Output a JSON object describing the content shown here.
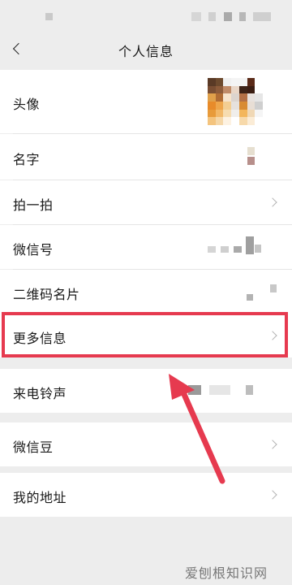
{
  "nav": {
    "title": "个人信息"
  },
  "rows": [
    {
      "label": "头像"
    },
    {
      "label": "名字"
    },
    {
      "label": "拍一拍"
    },
    {
      "label": "微信号"
    },
    {
      "label": "二维码名片"
    },
    {
      "label": "更多信息"
    },
    {
      "label": "来电铃声"
    },
    {
      "label": "微信豆"
    },
    {
      "label": "我的地址"
    }
  ],
  "watermark": "爱刨根知识网",
  "colors": {
    "highlight": "#e63a4f",
    "background": "#ededed",
    "chevron": "#b2b2b2"
  },
  "icons": [
    "back-arrow-icon",
    "chevron-right-icon"
  ]
}
